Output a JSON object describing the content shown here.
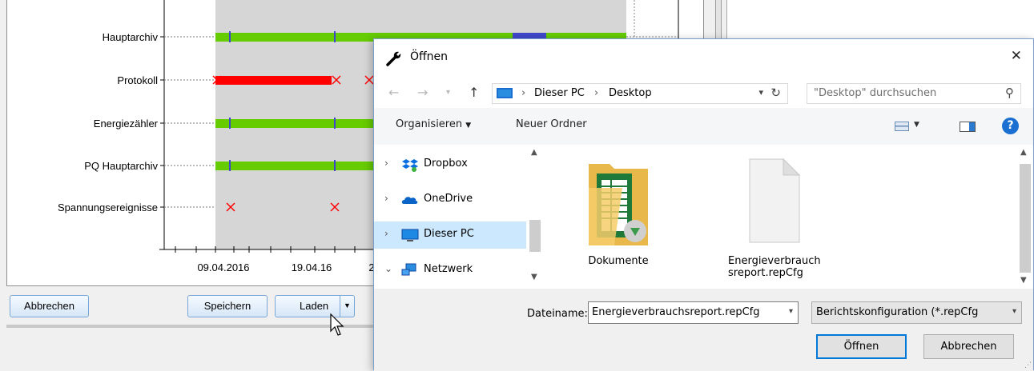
{
  "chart": {
    "rows": [
      "Hauptarchiv",
      "Protokoll",
      "Energiezähler",
      "PQ Hauptarchiv",
      "Spannungsereignisse"
    ],
    "x_ticks": [
      "09.04.2016",
      "19.04.16",
      "2"
    ],
    "colors": {
      "available": "#66cc00",
      "error": "#ff0000",
      "marker": "#3f48cc",
      "range_bg": "#d6d6d6"
    }
  },
  "buttons": {
    "cancel": "Abbrechen",
    "save": "Speichern",
    "load": "Laden"
  },
  "dialog": {
    "title": "Öffnen",
    "breadcrumb": [
      "Dieser PC",
      "Desktop"
    ],
    "search_placeholder": "\"Desktop\" durchsuchen",
    "toolbar": {
      "organize": "Organisieren",
      "new_folder": "Neuer Ordner"
    },
    "nav_items": [
      {
        "label": "Dropbox",
        "expanded": false
      },
      {
        "label": "OneDrive",
        "expanded": false
      },
      {
        "label": "Dieser PC",
        "expanded": false,
        "selected": true
      },
      {
        "label": "Netzwerk",
        "expanded": true
      }
    ],
    "files": [
      {
        "name": "Dokumente",
        "type": "folder"
      },
      {
        "name": "Energieverbrauch\nsreport.repCfg",
        "type": "file"
      }
    ],
    "filename_label": "Dateiname:",
    "filename_value": "Energieverbrauchsreport.repCfg",
    "filetype_value": "Berichtskonfiguration (*.repCfg",
    "open_button": "Öffnen",
    "cancel_button": "Abbrechen"
  }
}
